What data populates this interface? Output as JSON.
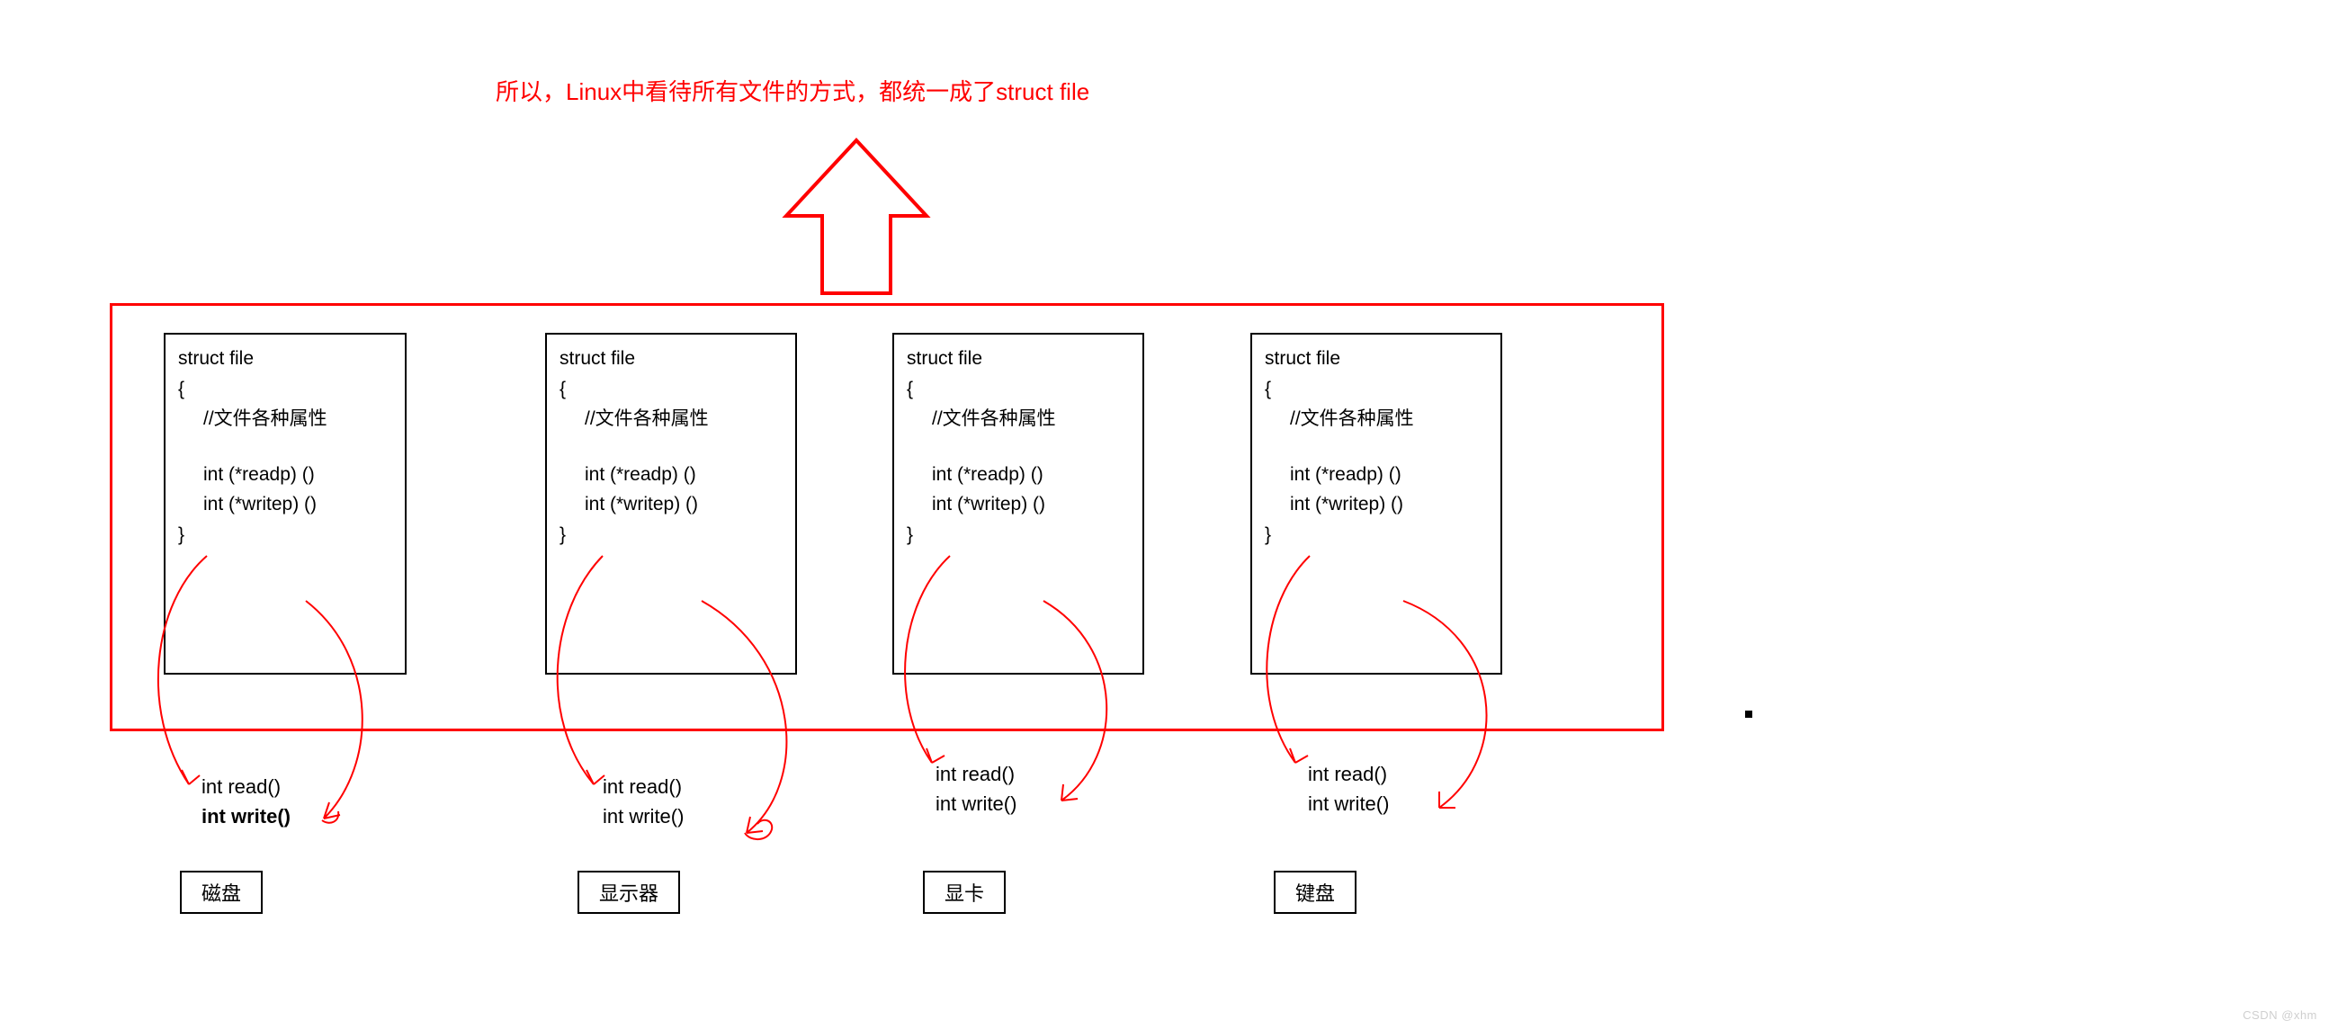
{
  "title": "所以，Linux中看待所有文件的方式，都统一成了struct file",
  "struct": {
    "head": "struct file",
    "open": "{",
    "comment": "//文件各种属性",
    "readp": "int (*readp) ()",
    "writep": "int (*writep) ()",
    "close": "}"
  },
  "fn": {
    "read": "int read()",
    "write": "int write()"
  },
  "devices": [
    "磁盘",
    "显示器",
    "显卡",
    "键盘"
  ],
  "watermark": "CSDN @xhm"
}
